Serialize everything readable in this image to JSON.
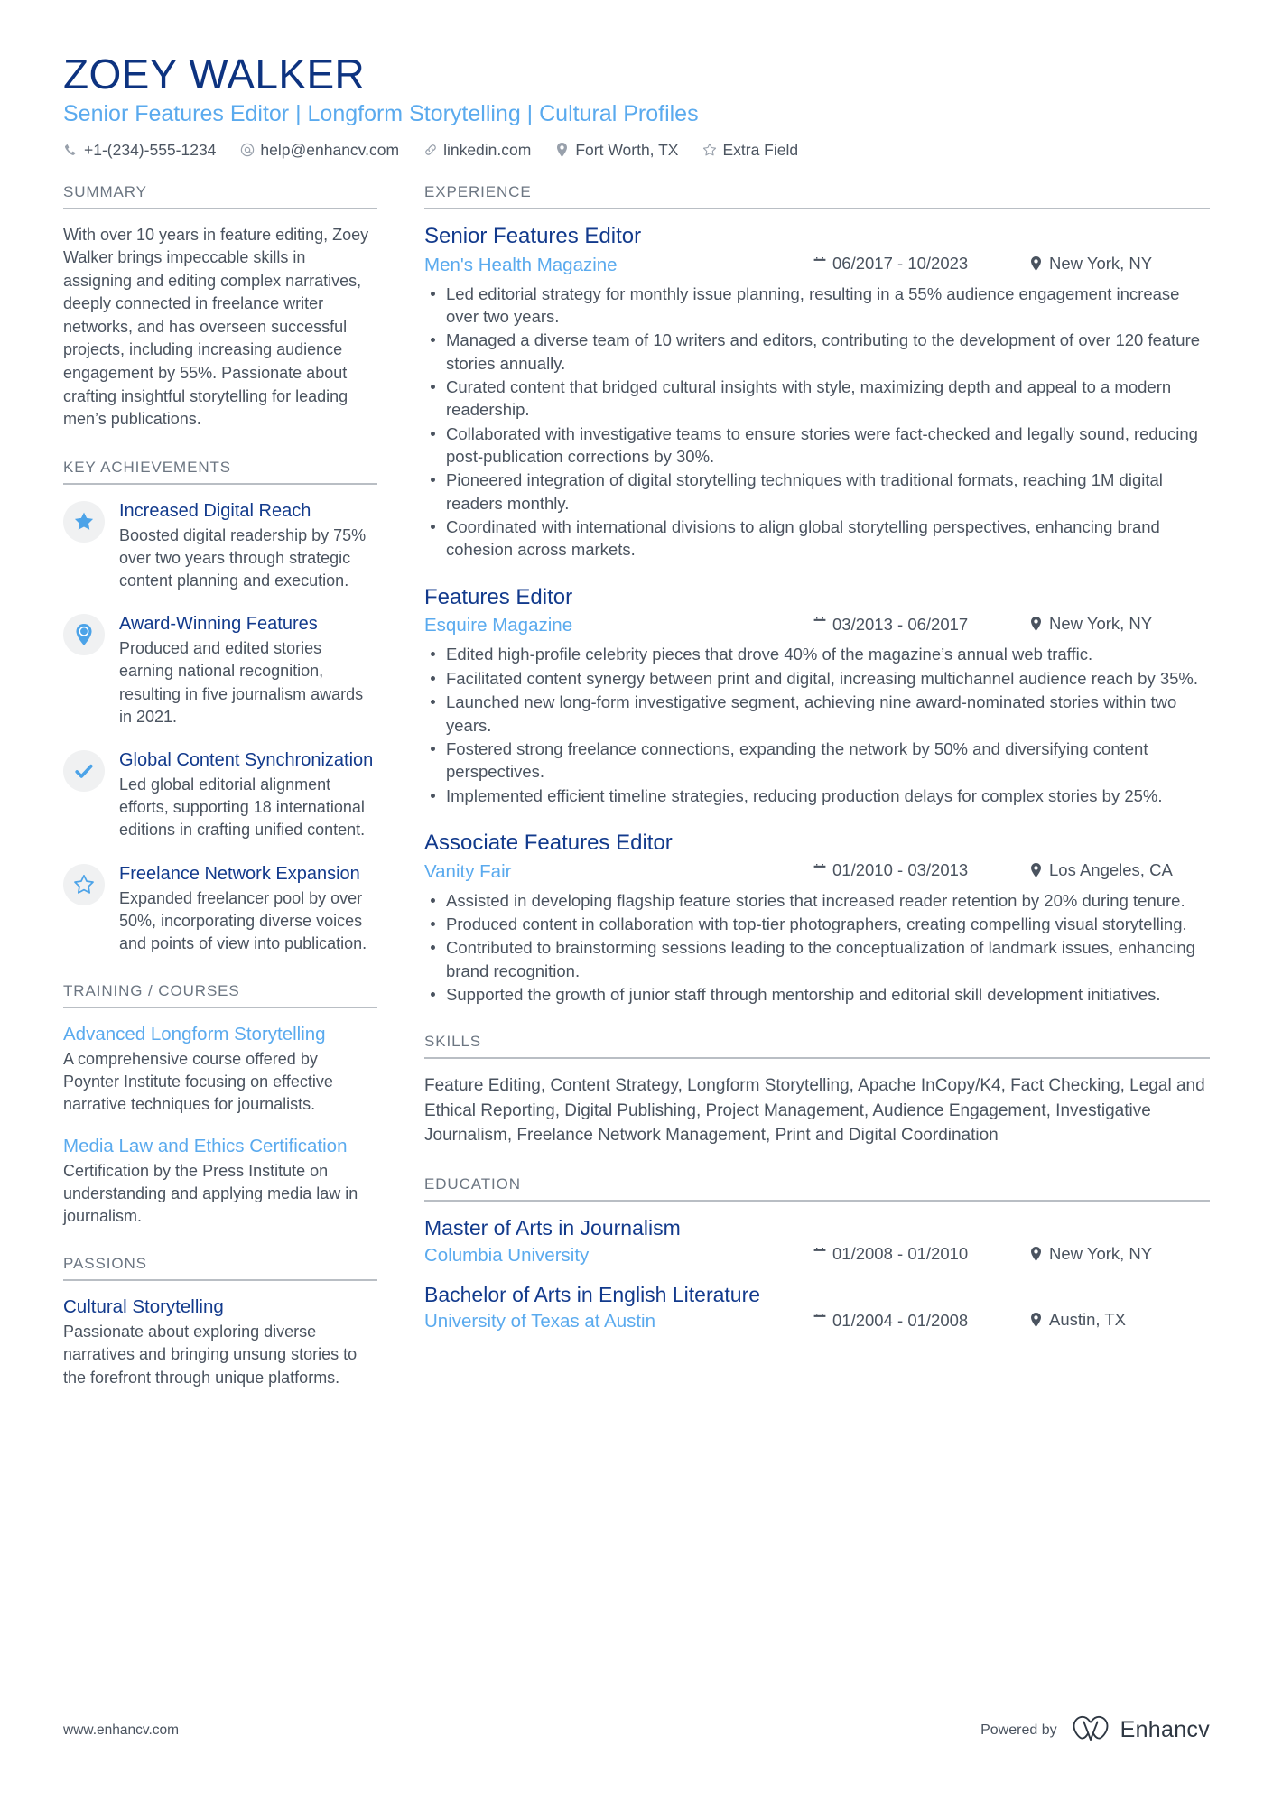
{
  "header": {
    "name": "ZOEY WALKER",
    "headline": "Senior Features Editor | Longform Storytelling | Cultural Profiles",
    "contacts": [
      {
        "icon": "phone-icon",
        "text": "+1-(234)-555-1234"
      },
      {
        "icon": "email-icon",
        "text": "help@enhancv.com"
      },
      {
        "icon": "link-icon",
        "text": "linkedin.com"
      },
      {
        "icon": "location-pin-icon",
        "text": "Fort Worth, TX"
      },
      {
        "icon": "star-outline-icon",
        "text": "Extra Field"
      }
    ]
  },
  "sections": {
    "summary_title": "SUMMARY",
    "achievements_title": "KEY ACHIEVEMENTS",
    "training_title": "TRAINING / COURSES",
    "passions_title": "PASSIONS",
    "experience_title": "EXPERIENCE",
    "skills_title": "SKILLS",
    "education_title": "EDUCATION"
  },
  "summary": {
    "text": "With over 10 years in feature editing, Zoey Walker brings impeccable skills in assigning and editing complex narratives, deeply connected in freelance writer networks, and has overseen successful projects, including increasing audience engagement by 55%. Passionate about crafting insightful storytelling for leading men’s publications."
  },
  "achievements": [
    {
      "icon": "star-filled-icon",
      "title": "Increased Digital Reach",
      "description": "Boosted digital readership by 75% over two years through strategic content planning and execution."
    },
    {
      "icon": "map-pin-icon",
      "title": "Award-Winning Features",
      "description": "Produced and edited stories earning national recognition, resulting in five journalism awards in 2021."
    },
    {
      "icon": "check-icon",
      "title": "Global Content Synchronization",
      "description": "Led global editorial alignment efforts, supporting 18 international editions in crafting unified content."
    },
    {
      "icon": "star-outline-icon",
      "title": "Freelance Network Expansion",
      "description": "Expanded freelancer pool by over 50%, incorporating diverse voices and points of view into publication."
    }
  ],
  "training": [
    {
      "title": "Advanced Longform Storytelling",
      "description": "A comprehensive course offered by Poynter Institute focusing on effective narrative techniques for journalists."
    },
    {
      "title": "Media Law and Ethics Certification",
      "description": "Certification by the Press Institute on understanding and applying media law in journalism."
    }
  ],
  "passions": [
    {
      "title": "Cultural Storytelling",
      "description": "Passionate about exploring diverse narratives and bringing unsung stories to the forefront through unique platforms."
    }
  ],
  "experience": [
    {
      "title": "Senior Features Editor",
      "company": "Men's Health Magazine",
      "dates": "06/2017 - 10/2023",
      "location": "New York, NY",
      "bullets": [
        "Led editorial strategy for monthly issue planning, resulting in a 55% audience engagement increase over two years.",
        "Managed a diverse team of 10 writers and editors, contributing to the development of over 120 feature stories annually.",
        "Curated content that bridged cultural insights with style, maximizing depth and appeal to a modern readership.",
        "Collaborated with investigative teams to ensure stories were fact-checked and legally sound, reducing post-publication corrections by 30%.",
        "Pioneered integration of digital storytelling techniques with traditional formats, reaching 1M digital readers monthly.",
        "Coordinated with international divisions to align global storytelling perspectives, enhancing brand cohesion across markets."
      ]
    },
    {
      "title": "Features Editor",
      "company": "Esquire Magazine",
      "dates": "03/2013 - 06/2017",
      "location": "New York, NY",
      "bullets": [
        "Edited high-profile celebrity pieces that drove 40% of the magazine’s annual web traffic.",
        "Facilitated content synergy between print and digital, increasing multichannel audience reach by 35%.",
        "Launched new long-form investigative segment, achieving nine award-nominated stories within two years.",
        "Fostered strong freelance connections, expanding the network by 50% and diversifying content perspectives.",
        "Implemented efficient timeline strategies, reducing production delays for complex stories by 25%."
      ]
    },
    {
      "title": "Associate Features Editor",
      "company": "Vanity Fair",
      "dates": "01/2010 - 03/2013",
      "location": "Los Angeles, CA",
      "bullets": [
        "Assisted in developing flagship feature stories that increased reader retention by 20% during tenure.",
        "Produced content in collaboration with top-tier photographers, creating compelling visual storytelling.",
        "Contributed to brainstorming sessions leading to the conceptualization of landmark issues, enhancing brand recognition.",
        "Supported the growth of junior staff through mentorship and editorial skill development initiatives."
      ]
    }
  ],
  "skills": {
    "text": "Feature Editing, Content Strategy, Longform Storytelling, Apache InCopy/K4, Fact Checking, Legal and Ethical Reporting, Digital Publishing, Project Management, Audience Engagement, Investigative Journalism, Freelance Network Management, Print and Digital Coordination"
  },
  "education": [
    {
      "degree": "Master of Arts in Journalism",
      "school": "Columbia University",
      "dates": "01/2008 - 01/2010",
      "location": "New York, NY"
    },
    {
      "degree": "Bachelor of Arts in English Literature",
      "school": "University of Texas at Austin",
      "dates": "01/2004 - 01/2008",
      "location": "Austin, TX"
    }
  ],
  "footer": {
    "url": "www.enhancv.com",
    "powered_by": "Powered by",
    "brand": "Enhancv"
  },
  "colors": {
    "navy": "#123a8c",
    "light_blue": "#5aaaee",
    "body_gray": "#4a535f",
    "rule_gray": "#b9bec4",
    "badge_bg": "#f0f1f2"
  }
}
